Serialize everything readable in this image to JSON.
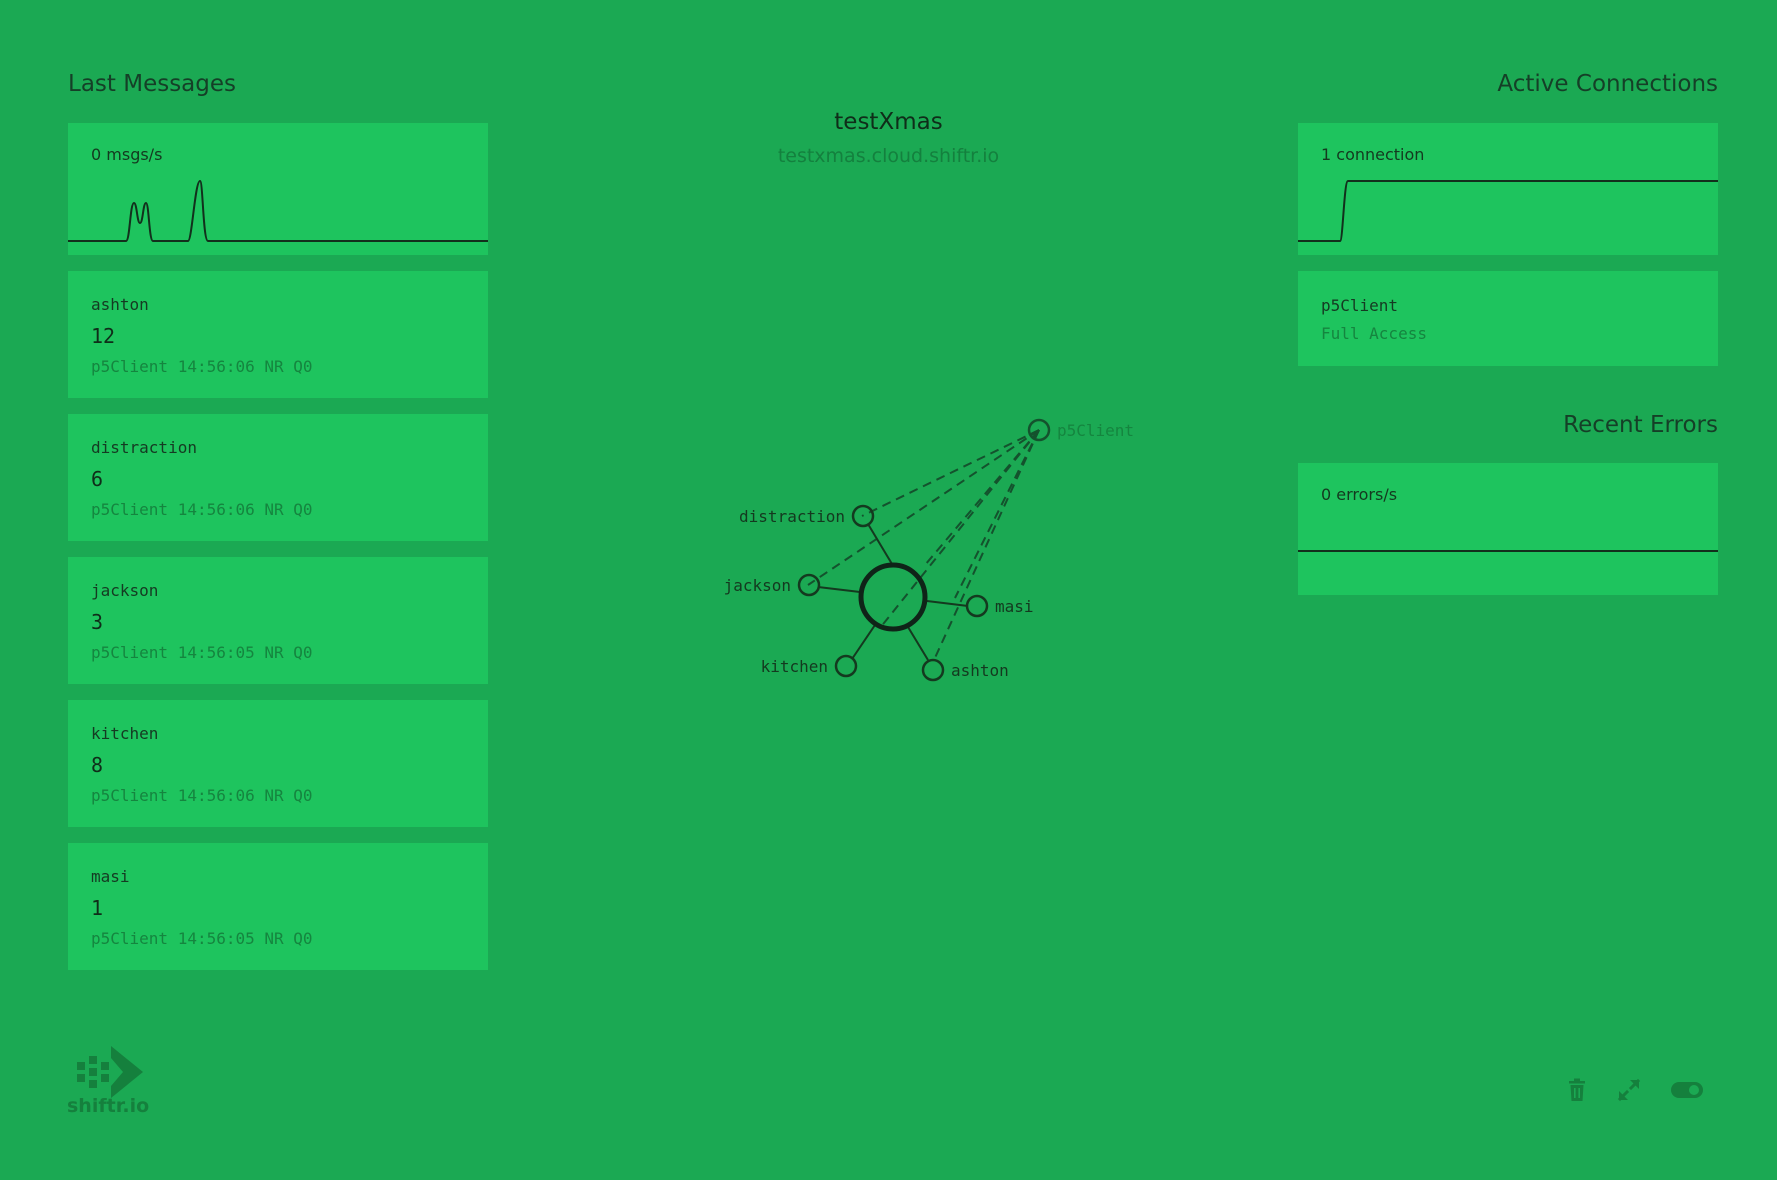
{
  "left": {
    "title": "Last Messages",
    "rate": "0 msgs/s",
    "messages": [
      {
        "topic": "ashton",
        "value": "12",
        "meta": "p5Client 14:56:06 NR Q0"
      },
      {
        "topic": "distraction",
        "value": "6",
        "meta": "p5Client 14:56:06 NR Q0"
      },
      {
        "topic": "jackson",
        "value": "3",
        "meta": "p5Client 14:56:05 NR Q0"
      },
      {
        "topic": "kitchen",
        "value": "8",
        "meta": "p5Client 14:56:06 NR Q0"
      },
      {
        "topic": "masi",
        "value": "1",
        "meta": "p5Client 14:56:05 NR Q0"
      }
    ]
  },
  "center": {
    "title": "testXmas",
    "subtitle": "testxmas.cloud.shiftr.io",
    "graph": {
      "client": "p5Client",
      "topics": [
        "distraction",
        "jackson",
        "masi",
        "kitchen",
        "ashton"
      ]
    }
  },
  "right": {
    "connections_title": "Active Connections",
    "connections_rate": "1 connection",
    "client": {
      "name": "p5Client",
      "access": "Full Access"
    },
    "errors_title": "Recent Errors",
    "errors_rate": "0 errors/s"
  },
  "footer": {
    "logo_text": "shiftr.io",
    "icons": [
      "trash-icon",
      "expand-icon",
      "toggle-icon"
    ]
  },
  "colors": {
    "background": "#1ba953",
    "card": "#1ec45e",
    "dark": "#14391f",
    "muted": "#15853f"
  }
}
